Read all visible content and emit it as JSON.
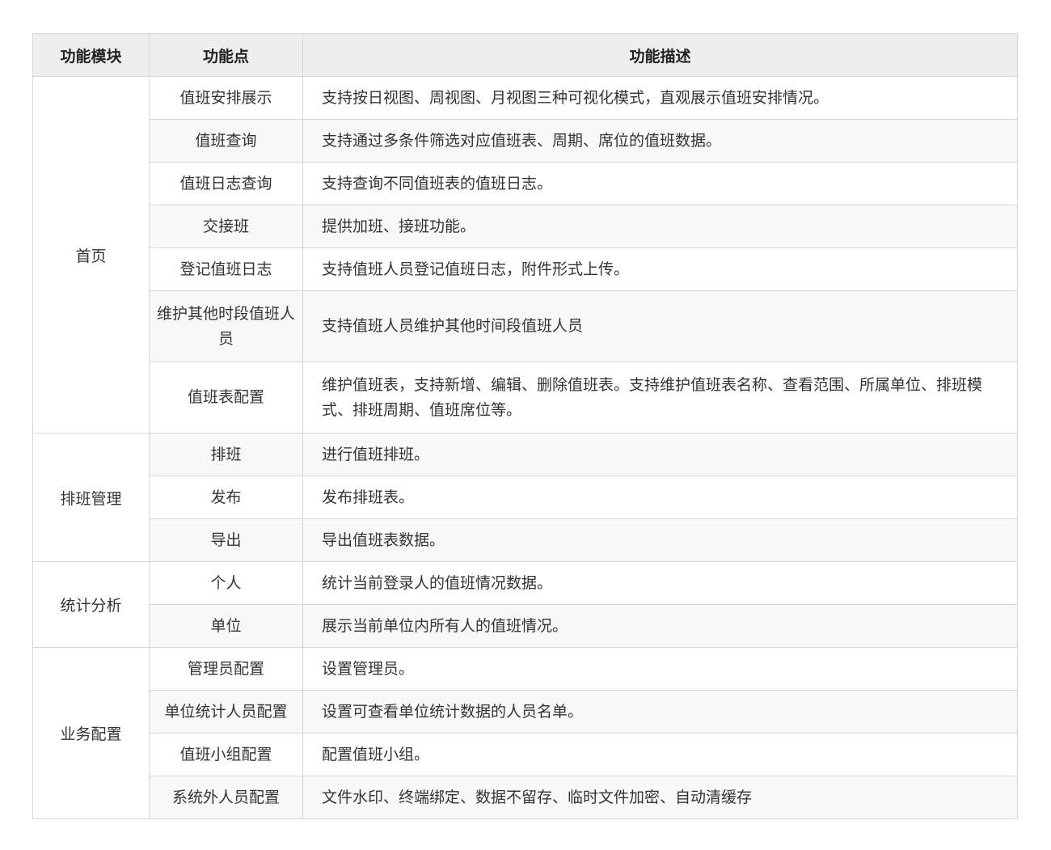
{
  "table": {
    "headers": {
      "module": "功能模块",
      "feature": "功能点",
      "description": "功能描述"
    },
    "groups": [
      {
        "module": "首页",
        "rows": [
          {
            "feature": "值班安排展示",
            "description": "支持按日视图、周视图、月视图三种可视化模式，直观展示值班安排情况。"
          },
          {
            "feature": "值班查询",
            "description": "支持通过多条件筛选对应值班表、周期、席位的值班数据。"
          },
          {
            "feature": "值班日志查询",
            "description": "支持查询不同值班表的值班日志。"
          },
          {
            "feature": "交接班",
            "description": "提供加班、接班功能。"
          },
          {
            "feature": "登记值班日志",
            "description": "支持值班人员登记值班日志，附件形式上传。"
          },
          {
            "feature": "维护其他时段值班人员",
            "description": "支持值班人员维护其他时间段值班人员"
          },
          {
            "feature": "值班表配置",
            "description": "维护值班表，支持新增、编辑、删除值班表。支持维护值班表名称、查看范围、所属单位、排班模式、排班周期、值班席位等。"
          }
        ]
      },
      {
        "module": "排班管理",
        "rows": [
          {
            "feature": "排班",
            "description": "进行值班排班。"
          },
          {
            "feature": "发布",
            "description": "发布排班表。"
          },
          {
            "feature": "导出",
            "description": "导出值班表数据。"
          }
        ]
      },
      {
        "module": "统计分析",
        "rows": [
          {
            "feature": "个人",
            "description": "统计当前登录人的值班情况数据。"
          },
          {
            "feature": "单位",
            "description": "展示当前单位内所有人的值班情况。"
          }
        ]
      },
      {
        "module": "业务配置",
        "rows": [
          {
            "feature": "管理员配置",
            "description": "设置管理员。"
          },
          {
            "feature": "单位统计人员配置",
            "description": "设置可查看单位统计数据的人员名单。"
          },
          {
            "feature": "值班小组配置",
            "description": "配置值班小组。"
          },
          {
            "feature": "系统外人员配置",
            "description": "文件水印、终端绑定、数据不留存、临时文件加密、自动清缓存"
          }
        ]
      }
    ]
  }
}
